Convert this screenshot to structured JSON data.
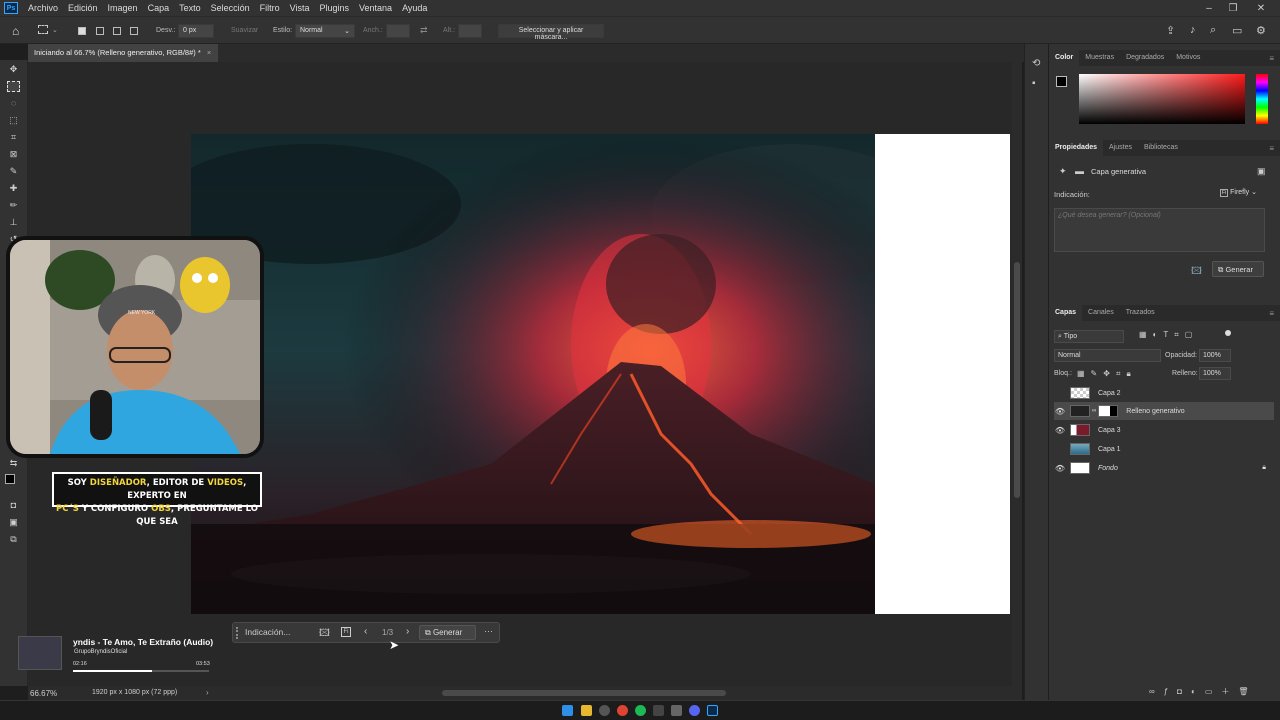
{
  "menubar": {
    "app_icon": "Ps",
    "items": [
      "Archivo",
      "Edición",
      "Imagen",
      "Capa",
      "Texto",
      "Selección",
      "Filtro",
      "Vista",
      "Plugins",
      "Ventana",
      "Ayuda"
    ]
  },
  "options": {
    "desv_label": "Desv.:",
    "desv_value": "0 px",
    "suavizar": "Suavizar",
    "estilo_label": "Estilo:",
    "estilo_value": "Normal",
    "anch_label": "Anch.:",
    "alt_label": "Alt.:",
    "mask_button": "Seleccionar y aplicar máscara..."
  },
  "document": {
    "tab_title": "Iniciando al 66.7% (Relleno generativo, RGB/8#) *",
    "zoom": "66.67%",
    "doc_info": "1920 px x 1080 px (72 ppp)"
  },
  "color_panel": {
    "tabs": [
      "Color",
      "Muestras",
      "Degradados",
      "Motivos"
    ],
    "accent_red": "#ff1a1a"
  },
  "properties_panel": {
    "tabs": [
      "Propiedades",
      "Ajustes",
      "Bibliotecas"
    ],
    "layer_type": "Capa generativa",
    "prompt_label": "Indicación:",
    "model": "Firefly",
    "prompt_placeholder": "¿Qué desea generar? (Opcional)",
    "generate_button": "Generar"
  },
  "layers_panel": {
    "tabs": [
      "Capas",
      "Canales",
      "Trazados"
    ],
    "filter_label": "Tipo",
    "blend_mode": "Normal",
    "opacity_label": "Opacidad:",
    "opacity_value": "100%",
    "lock_label": "Bloq.:",
    "fill_label": "Relleno:",
    "fill_value": "100%",
    "layers": [
      {
        "name": "Capa 2",
        "visible": false
      },
      {
        "name": "Relleno generativo",
        "visible": true
      },
      {
        "name": "Capa 3",
        "visible": true
      },
      {
        "name": "Capa 1",
        "visible": false
      },
      {
        "name": "Fondo",
        "visible": true
      }
    ]
  },
  "generative_bar": {
    "placeholder": "Indicación...",
    "counter": "1/3",
    "generate_label": "Generar"
  },
  "overlay": {
    "caption_line1_a": "SOY ",
    "caption_line1_b": "DISEÑADOR",
    "caption_line1_c": ", EDITOR DE ",
    "caption_line1_d": "VIDEOS",
    "caption_line1_e": ", EXPERTO EN",
    "caption_line2_a": "PC´S",
    "caption_line2_b": " Y CONFIGURO ",
    "caption_line2_c": "OBS",
    "caption_line2_d": ", PREGUNTAME LO QUE SEA",
    "cap_text": "NEW YORK"
  },
  "music": {
    "title": "yndis - Te Amo, Te Extraño (Audio)",
    "channel": "GrupoBryndisOficial",
    "elapsed": "02:16",
    "total": "03:53",
    "progress": 0.58
  }
}
